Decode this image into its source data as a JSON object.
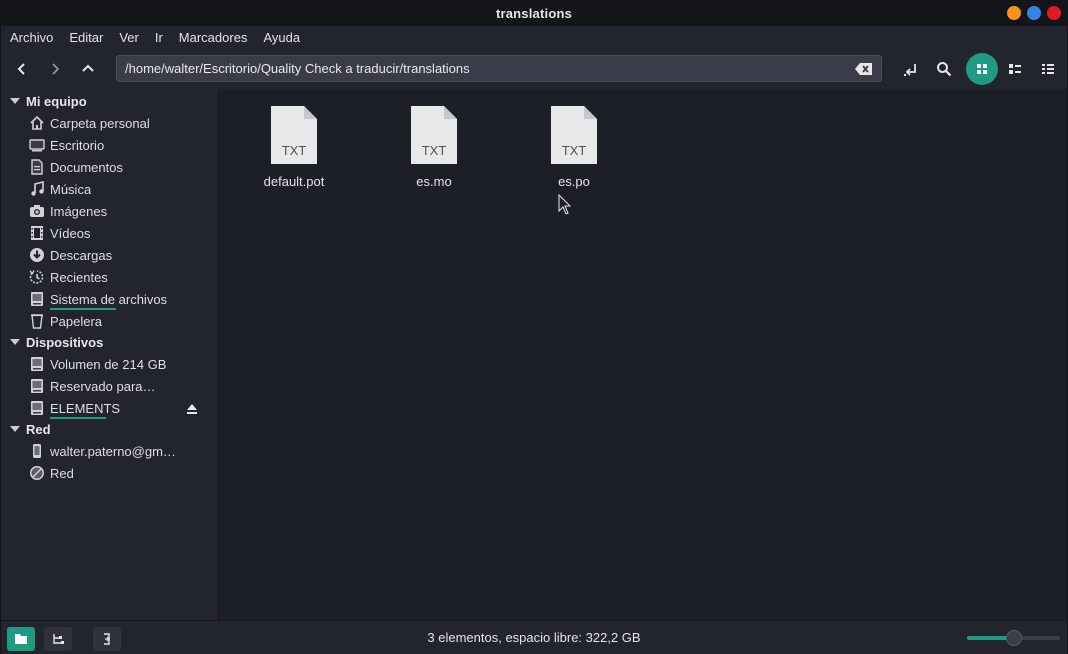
{
  "window": {
    "title": "translations"
  },
  "menubar": {
    "items": [
      "Archivo",
      "Editar",
      "Ver",
      "Ir",
      "Marcadores",
      "Ayuda"
    ]
  },
  "toolbar": {
    "path": "/home/walter/Escritorio/Quality Check a traducir/translations"
  },
  "sidebar": {
    "sections": [
      {
        "title": "Mi equipo"
      },
      {
        "title": "Dispositivos"
      },
      {
        "title": "Red"
      }
    ],
    "mi_equipo": [
      {
        "label": "Carpeta personal",
        "icon": "home-icon"
      },
      {
        "label": "Escritorio",
        "icon": "desktop-icon"
      },
      {
        "label": "Documentos",
        "icon": "documents-icon"
      },
      {
        "label": "Música",
        "icon": "music-icon"
      },
      {
        "label": "Imágenes",
        "icon": "camera-icon"
      },
      {
        "label": "Vídeos",
        "icon": "film-icon"
      },
      {
        "label": "Descargas",
        "icon": "download-icon"
      },
      {
        "label": "Recientes",
        "icon": "recent-icon"
      },
      {
        "label": "Sistema de archivos",
        "icon": "drive-icon"
      },
      {
        "label": "Papelera",
        "icon": "trash-icon"
      }
    ],
    "dispositivos": [
      {
        "label": "Volumen de 214 GB",
        "icon": "drive-icon"
      },
      {
        "label": "Reservado para el sistema",
        "icon": "drive-icon"
      },
      {
        "label": "ELEMENTS",
        "icon": "drive-icon"
      }
    ],
    "red": [
      {
        "label": "walter.paterno@gmail.com",
        "icon": "phone-icon"
      },
      {
        "label": "Red",
        "icon": "network-icon"
      }
    ]
  },
  "files": [
    {
      "name": "default.pot",
      "type": "TXT"
    },
    {
      "name": "es.mo",
      "type": "TXT"
    },
    {
      "name": "es.po",
      "type": "TXT"
    }
  ],
  "statusbar": {
    "text": "3 elementos, espacio libre: 322,2 GB",
    "zoom": 0.5
  },
  "colors": {
    "accent": "#1f9b83",
    "background": "#1d1f26",
    "panel": "#23252e"
  }
}
